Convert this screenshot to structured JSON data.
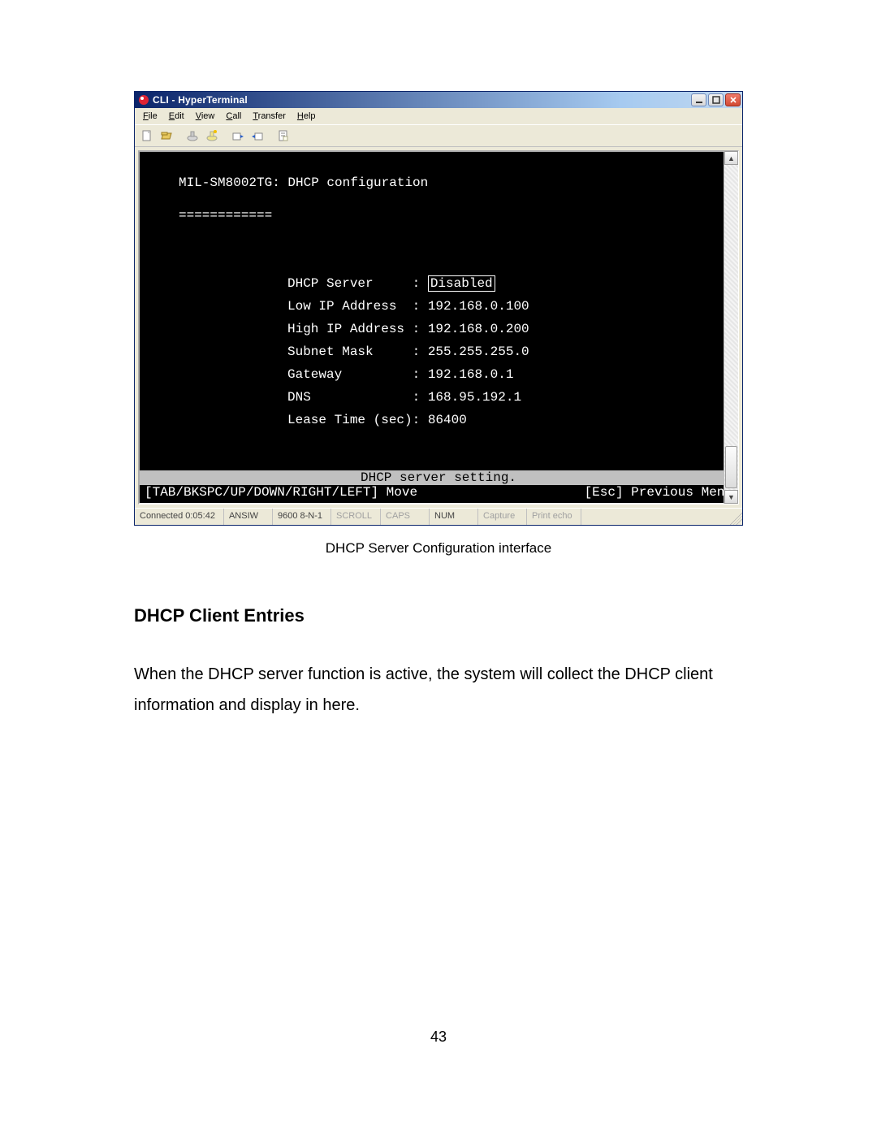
{
  "window": {
    "title": "CLI - HyperTerminal",
    "menus": {
      "file": {
        "underlined": "F",
        "rest": "ile"
      },
      "edit": {
        "underlined": "E",
        "rest": "dit"
      },
      "view": {
        "underlined": "V",
        "rest": "iew"
      },
      "call": {
        "underlined": "C",
        "rest": "all"
      },
      "transfer": {
        "underlined": "T",
        "rest": "ransfer"
      },
      "help": {
        "underlined": "H",
        "rest": "elp"
      }
    }
  },
  "terminal": {
    "header": "MIL-SM8002TG: DHCP configuration",
    "hr": "============",
    "fields": [
      {
        "label": "DHCP Server    ",
        "sep": ": ",
        "value": "Disabled",
        "selected": true
      },
      {
        "label": "Low IP Address ",
        "sep": ": ",
        "value": "192.168.0.100",
        "selected": false
      },
      {
        "label": "High IP Address",
        "sep": ": ",
        "value": "192.168.0.200",
        "selected": false
      },
      {
        "label": "Subnet Mask    ",
        "sep": ": ",
        "value": "255.255.255.0",
        "selected": false
      },
      {
        "label": "Gateway        ",
        "sep": ": ",
        "value": "192.168.0.1",
        "selected": false
      },
      {
        "label": "DNS            ",
        "sep": ": ",
        "value": "168.95.192.1",
        "selected": false
      },
      {
        "label": "Lease Time (sec)",
        "sep": ":",
        "value": "86400",
        "selected": false
      }
    ],
    "bar": "DHCP server setting.",
    "nav_left": "[TAB/BKSPC/UP/DOWN/RIGHT/LEFT] Move",
    "nav_right": "[Esc] Previous Menu"
  },
  "statusbar": {
    "connected": "Connected 0:05:42",
    "emulation": "ANSIW",
    "port": "9600 8-N-1",
    "scroll": "SCROLL",
    "caps": "CAPS",
    "num": "NUM",
    "capture": "Capture",
    "printecho": "Print echo"
  },
  "caption": "DHCP Server Configuration interface",
  "heading": "DHCP Client Entries",
  "paragraph": "When the DHCP server function is active, the system will collect the DHCP client information and display in here.",
  "page_number": "43"
}
